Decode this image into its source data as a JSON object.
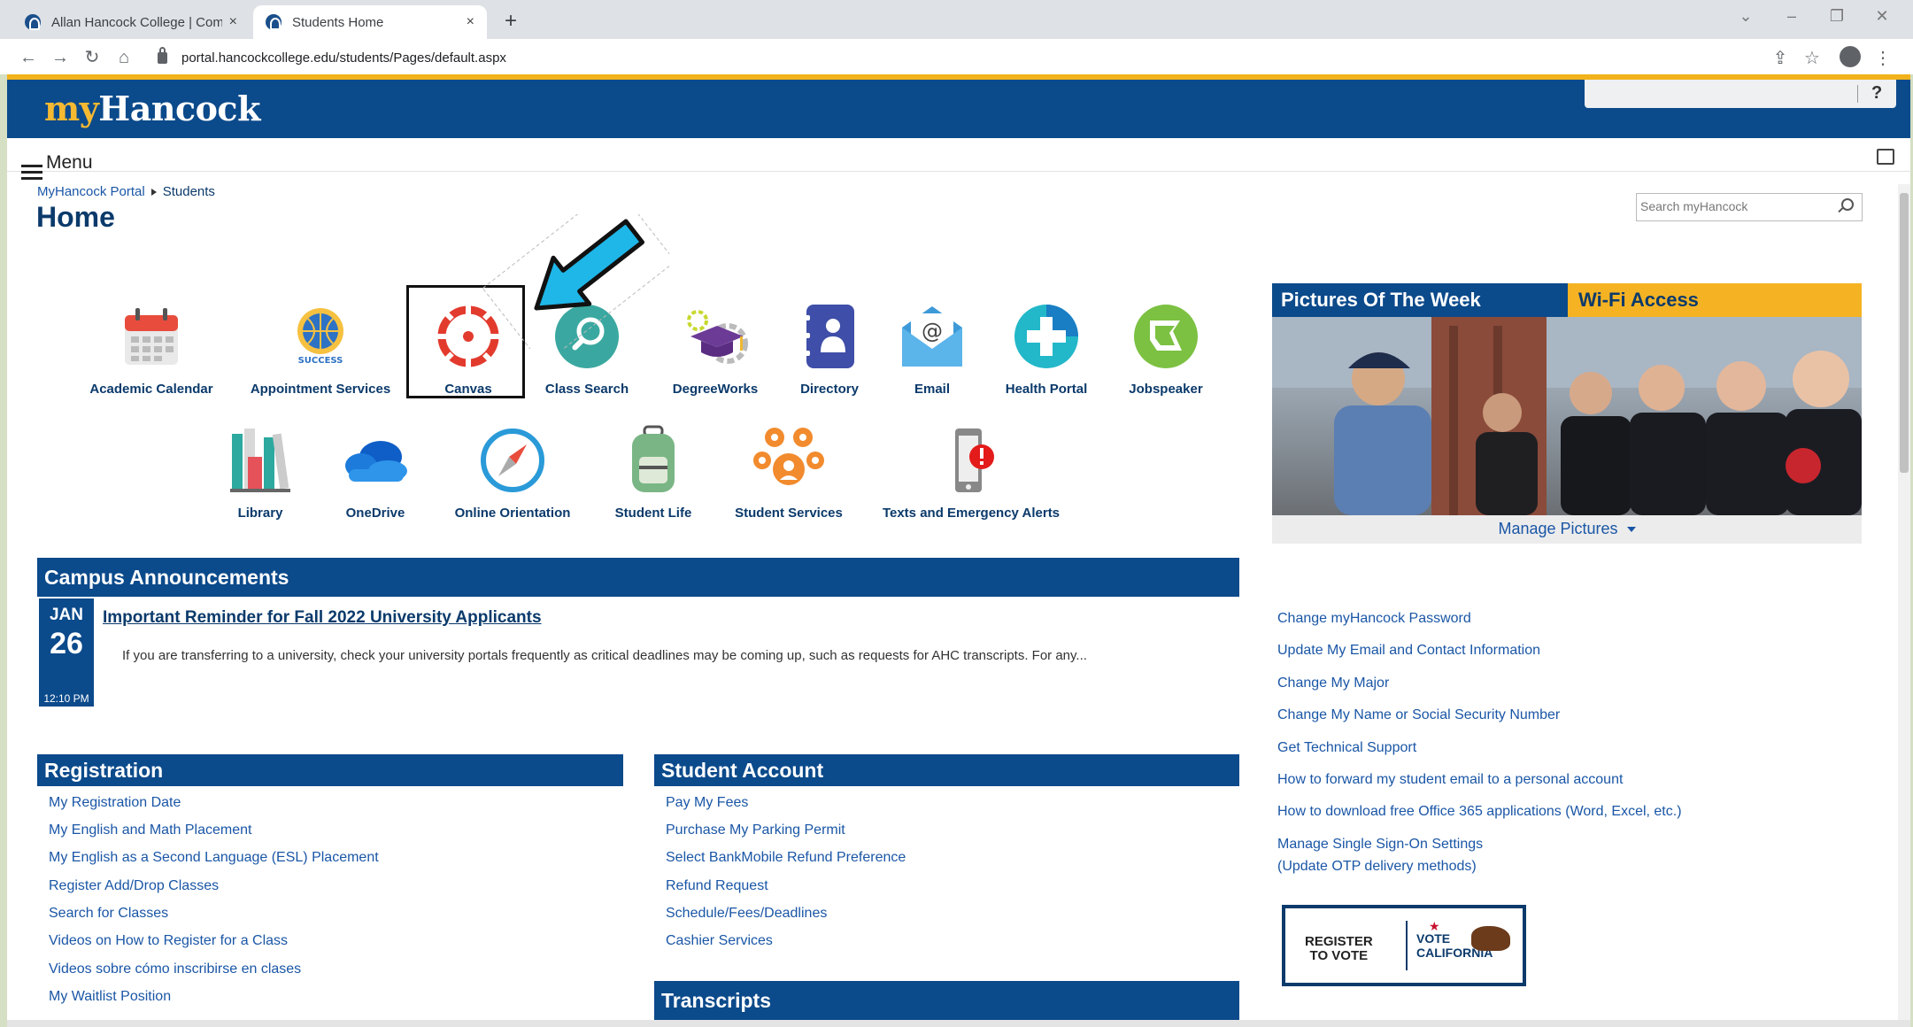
{
  "browser": {
    "tabs": [
      {
        "title": "Allan Hancock College | Commu",
        "active": false
      },
      {
        "title": "Students Home",
        "active": true
      }
    ],
    "url": "portal.hancockcollege.edu/students/Pages/default.aspx",
    "new_tab": "+",
    "close": "×"
  },
  "header": {
    "logo_my": "my",
    "logo_rest": "Hancock",
    "help": "?"
  },
  "menu": {
    "label": "Menu"
  },
  "breadcrumb": {
    "root": "MyHancock Portal",
    "current": "Students"
  },
  "page_title": "Home",
  "site_search": {
    "placeholder": "Search myHancock"
  },
  "apps": [
    {
      "label": "Academic Calendar",
      "icon": "calendar-icon"
    },
    {
      "label": "Appointment Services",
      "icon": "successnet-icon"
    },
    {
      "label": "Canvas",
      "icon": "canvas-icon",
      "highlighted": true
    },
    {
      "label": "Class Search",
      "icon": "magnifier-icon"
    },
    {
      "label": "DegreeWorks",
      "icon": "graduation-cap-icon"
    },
    {
      "label": "Directory",
      "icon": "contact-book-icon"
    },
    {
      "label": "Email",
      "icon": "envelope-icon"
    },
    {
      "label": "Health Portal",
      "icon": "medical-cross-icon"
    },
    {
      "label": "Jobspeaker",
      "icon": "jobspeaker-icon"
    },
    {
      "label": "Library",
      "icon": "books-icon"
    },
    {
      "label": "OneDrive",
      "icon": "cloud-icon"
    },
    {
      "label": "Online Orientation",
      "icon": "compass-icon"
    },
    {
      "label": "Student Life",
      "icon": "backpack-icon"
    },
    {
      "label": "Student Services",
      "icon": "people-group-icon"
    },
    {
      "label": "Texts and Emergency Alerts",
      "icon": "phone-alert-icon"
    }
  ],
  "pictures": {
    "tab_pictures": "Pictures Of The Week",
    "tab_wifi": "Wi-Fi Access",
    "manage": "Manage Pictures"
  },
  "announcements": {
    "title": "Campus Announcements",
    "items": [
      {
        "month": "JAN",
        "day": "26",
        "time": "12:10 PM",
        "headline": "Important Reminder for Fall 2022 University Applicants",
        "summary": "If you are transferring to a university, check your university portals frequently as critical deadlines may be coming up, such as requests for AHC transcripts. For any..."
      }
    ]
  },
  "registration": {
    "title": "Registration",
    "links": [
      "My Registration Date",
      "My English and Math Placement",
      "My English as a Second Language (ESL) Placement",
      "Register Add/Drop Classes",
      "Search for Classes",
      "Videos on How to Register for a Class",
      "Videos sobre cómo inscribirse en clases",
      "My Waitlist Position"
    ]
  },
  "student_account": {
    "title": "Student Account",
    "links": [
      "Pay My Fees",
      "Purchase My Parking Permit",
      "Select BankMobile Refund Preference",
      "Refund Request",
      "Schedule/Fees/Deadlines",
      "Cashier Services"
    ]
  },
  "transcripts": {
    "title": "Transcripts"
  },
  "quick_links": [
    "Change myHancock Password",
    "Update My Email and Contact Information",
    "Change My Major",
    "Change My Name or Social Security Number",
    "Get Technical Support",
    "How to forward my student email to a personal account",
    "How to download free Office 365 applications (Word, Excel, etc.)",
    "Manage Single Sign-On Settings",
    "(Update OTP delivery methods)"
  ],
  "vote_banner": {
    "left_line1": "REGISTER",
    "left_line2": "TO VOTE",
    "right_line1": "VOTE",
    "right_line2": "CALIFORNIA"
  },
  "colors": {
    "brand_blue": "#0b4a8b",
    "brand_gold": "#f2b21b",
    "link_blue": "#1a56a6",
    "highlight_arrow": "#1fb6e8"
  }
}
